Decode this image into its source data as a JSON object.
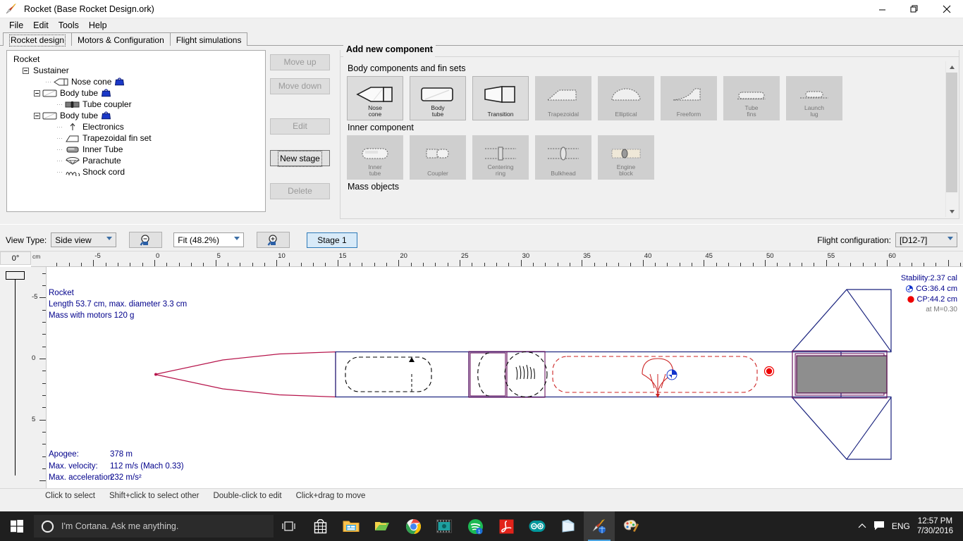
{
  "window": {
    "title": "Rocket (Base Rocket Design.ork)",
    "app_icon": "rocket-icon",
    "minimize": "–",
    "maximize": "❐",
    "close": "✕"
  },
  "menubar": {
    "items": [
      "File",
      "Edit",
      "Tools",
      "Help"
    ]
  },
  "tabs": [
    {
      "label": "Rocket design",
      "active": true
    },
    {
      "label": "Motors & Configuration",
      "active": false
    },
    {
      "label": "Flight simulations",
      "active": false
    }
  ],
  "tree": {
    "nodes": [
      {
        "label": "Rocket",
        "indent": 0,
        "expander": false,
        "icon": "",
        "mass": false
      },
      {
        "label": "Sustainer",
        "indent": 1,
        "expander": true,
        "icon": "",
        "mass": false
      },
      {
        "label": "Nose cone",
        "indent": 3,
        "expander": false,
        "icon": "nose-cone-icon",
        "mass": true
      },
      {
        "label": "Body tube",
        "indent": 2,
        "expander": true,
        "icon": "body-tube-icon",
        "mass": true
      },
      {
        "label": "Tube coupler",
        "indent": 4,
        "expander": false,
        "icon": "coupler-icon",
        "mass": false
      },
      {
        "label": "Body tube",
        "indent": 2,
        "expander": true,
        "icon": "body-tube-icon",
        "mass": true
      },
      {
        "label": "Electronics",
        "indent": 4,
        "expander": false,
        "icon": "mass-object-icon",
        "mass": false
      },
      {
        "label": "Trapezoidal fin set",
        "indent": 4,
        "expander": false,
        "icon": "fin-set-icon",
        "mass": false
      },
      {
        "label": "Inner Tube",
        "indent": 4,
        "expander": false,
        "icon": "inner-tube-icon",
        "mass": false
      },
      {
        "label": "Parachute",
        "indent": 4,
        "expander": false,
        "icon": "parachute-icon",
        "mass": false
      },
      {
        "label": "Shock cord",
        "indent": 4,
        "expander": false,
        "icon": "shock-cord-icon",
        "mass": false
      }
    ]
  },
  "tree_buttons": [
    {
      "label": "Move up",
      "enabled": false
    },
    {
      "label": "Move down",
      "enabled": false
    },
    {
      "label": "Edit",
      "enabled": false
    },
    {
      "label": "New stage",
      "enabled": true
    },
    {
      "label": "Delete",
      "enabled": false
    }
  ],
  "add_component": {
    "title": "Add new component",
    "sections": [
      {
        "label": "Body components and fin sets",
        "rows": [
          [
            {
              "label": "Nose cone",
              "icon": "nose-cone-icon",
              "enabled": true
            },
            {
              "label": "Body tube",
              "icon": "body-tube-icon",
              "enabled": true
            },
            {
              "label": "Transition",
              "icon": "transition-icon",
              "enabled": true
            },
            {
              "label": "Trapezoidal",
              "icon": "trapezoid-fin-icon",
              "enabled": false
            },
            {
              "label": "Elliptical",
              "icon": "elliptical-fin-icon",
              "enabled": false
            },
            {
              "label": "Freeform",
              "icon": "freeform-fin-icon",
              "enabled": false
            },
            {
              "label": "Tube fins",
              "icon": "tube-fins-icon",
              "enabled": false
            },
            {
              "label": "Launch lug",
              "icon": "launch-lug-icon",
              "enabled": false
            }
          ]
        ]
      },
      {
        "label": "Inner component",
        "rows": [
          [
            {
              "label": "Inner tube",
              "icon": "inner-tube-icon",
              "enabled": false
            },
            {
              "label": "Coupler",
              "icon": "coupler-icon",
              "enabled": false
            },
            {
              "label": "Centering ring",
              "icon": "centering-ring-icon",
              "enabled": false
            },
            {
              "label": "Bulkhead",
              "icon": "bulkhead-icon",
              "enabled": false
            },
            {
              "label": "Engine block",
              "icon": "engine-block-icon",
              "enabled": false
            }
          ]
        ]
      },
      {
        "label": "Mass objects",
        "rows": []
      }
    ]
  },
  "viewbar": {
    "view_type_label": "View Type:",
    "view_type_value": "Side view",
    "zoom_out_icon": "zoom-out-icon",
    "zoom_in_icon": "zoom-in-icon",
    "zoom_value": "Fit (48.2%)",
    "stage_button": "Stage 1",
    "flight_config_label": "Flight configuration:",
    "flight_config_value": "[D12-7]"
  },
  "canvas": {
    "rotation": "0°",
    "ruler_unit": "cm",
    "h_ticks": [
      -5,
      0,
      5,
      10,
      15,
      20,
      25,
      30,
      35,
      40,
      45,
      50,
      55,
      60
    ],
    "v_ticks": [
      -5,
      0,
      5
    ],
    "info_lines": [
      "Rocket",
      "Length 53.7 cm, max. diameter 3.3 cm",
      "Mass with motors 120 g"
    ],
    "right_info": {
      "stability": "Stability:2.37 cal",
      "cg": "CG:36.4 cm",
      "cp": "CP:44.2 cm",
      "at_mach": "at M=0.30",
      "cg_color": "#1133cc",
      "cp_color": "#ee0000"
    },
    "stats": [
      {
        "label": "Apogee:",
        "value": "378 m"
      },
      {
        "label": "Max. velocity:",
        "value": "112 m/s  (Mach 0.33)"
      },
      {
        "label": "Max. acceleration:",
        "value": "232 m/s²"
      }
    ]
  },
  "hints": [
    "Click to select",
    "Shift+click to select other",
    "Double-click to edit",
    "Click+drag to move"
  ],
  "taskbar": {
    "start_icon": "windows-start-icon",
    "cortana_icon": "cortana-circle-icon",
    "cortana_placeholder": "I'm Cortana. Ask me anything.",
    "task_view_icon": "task-view-icon",
    "apps": [
      {
        "name": "store-icon",
        "active": false
      },
      {
        "name": "file-explorer-icon",
        "active": false
      },
      {
        "name": "folder-icon",
        "active": false
      },
      {
        "name": "chrome-icon",
        "active": false
      },
      {
        "name": "video-editor-icon",
        "active": false
      },
      {
        "name": "spotify-icon",
        "active": false,
        "badge": "1"
      },
      {
        "name": "acrobat-reader-icon",
        "active": false
      },
      {
        "name": "arduino-icon",
        "active": false
      },
      {
        "name": "sticky-notes-icon",
        "active": false
      },
      {
        "name": "openrocket-icon",
        "active": true
      },
      {
        "name": "paint-icon",
        "active": false
      }
    ],
    "tray": {
      "chevron": "show-hidden-icons",
      "action_center": "action-center-icon",
      "language": "ENG",
      "time": "12:57 PM",
      "date": "7/30/2016"
    }
  },
  "colors": {
    "accent": "#2e7ab8",
    "nose_cone": "#b6134a",
    "body_tube": "#1a237e",
    "coupler": "#7b1b6b",
    "parachute": "#cc2222",
    "motor": "#8e8e8e"
  }
}
